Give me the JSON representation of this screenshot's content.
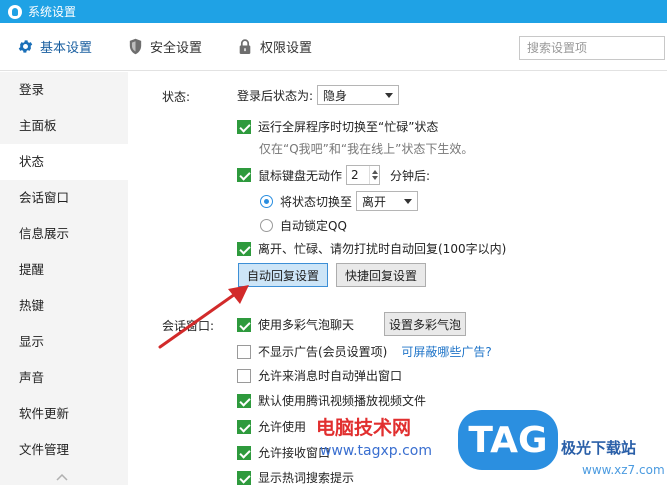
{
  "window": {
    "title": "系统设置"
  },
  "tabs": [
    {
      "label": "基本设置",
      "icon": "gear-icon",
      "active": true
    },
    {
      "label": "安全设置",
      "icon": "shield-icon",
      "active": false
    },
    {
      "label": "权限设置",
      "icon": "lock-icon",
      "active": false
    }
  ],
  "search": {
    "placeholder": "搜索设置项",
    "value": ""
  },
  "sidebar": {
    "items": [
      {
        "label": "登录"
      },
      {
        "label": "主面板"
      },
      {
        "label": "状态",
        "active": true
      },
      {
        "label": "会话窗口"
      },
      {
        "label": "信息展示"
      },
      {
        "label": "提醒"
      },
      {
        "label": "热键"
      },
      {
        "label": "显示"
      },
      {
        "label": "声音"
      },
      {
        "label": "软件更新"
      },
      {
        "label": "文件管理"
      }
    ]
  },
  "status_section": {
    "label": "状态:",
    "login_status_label": "登录后状态为:",
    "login_status_value": "隐身",
    "fullscreen_busy": {
      "label": "运行全屏程序时切换至“忙碌”状态",
      "checked": true
    },
    "fullscreen_hint": "仅在“Q我吧”和“我在线上”状态下生效。",
    "idle": {
      "label": "鼠标键盘无动作",
      "checked": true,
      "minutes": "2",
      "suffix": "分钟后:"
    },
    "switch_status": {
      "label": "将状态切换至",
      "checked": true,
      "value": "离开"
    },
    "auto_lock": {
      "label": "自动锁定QQ",
      "checked": false
    },
    "auto_reply": {
      "label": "离开、忙碌、请勿打扰时自动回复(100字以内)",
      "checked": true
    },
    "auto_reply_button": "自动回复设置",
    "quick_reply_button": "快捷回复设置"
  },
  "chat_section": {
    "label": "会话窗口:",
    "bubble": {
      "label": "使用多彩气泡聊天",
      "checked": true
    },
    "bubble_button": "设置多彩气泡",
    "no_ads": {
      "label": "不显示广告(会员设置项)",
      "checked": false
    },
    "ads_link": "可屏蔽哪些广告?",
    "popup": {
      "label": "允许来消息时自动弹出窗口",
      "checked": false
    },
    "default_video": {
      "label": "默认使用腾讯视频播放视频文件",
      "checked": true
    },
    "allow_use": {
      "label": "允许使用",
      "checked": true
    },
    "allow_receive": {
      "label": "允许接收窗口",
      "checked": true
    },
    "hot_search": {
      "label": "显示热词搜索提示",
      "checked": true
    }
  },
  "watermark": {
    "site_name": "电脑技术网",
    "site_url": "www.tagxp.com",
    "tag_logo": "TAG",
    "download_name": "极光下载站",
    "download_url": "www.xz7.com"
  },
  "colors": {
    "title_bar": "#1fa2e5",
    "checkbox_checked": "#2e9a3d",
    "highlight_button": "#cde5f7",
    "link": "#1f74c8",
    "arrow": "#d22a2a"
  }
}
